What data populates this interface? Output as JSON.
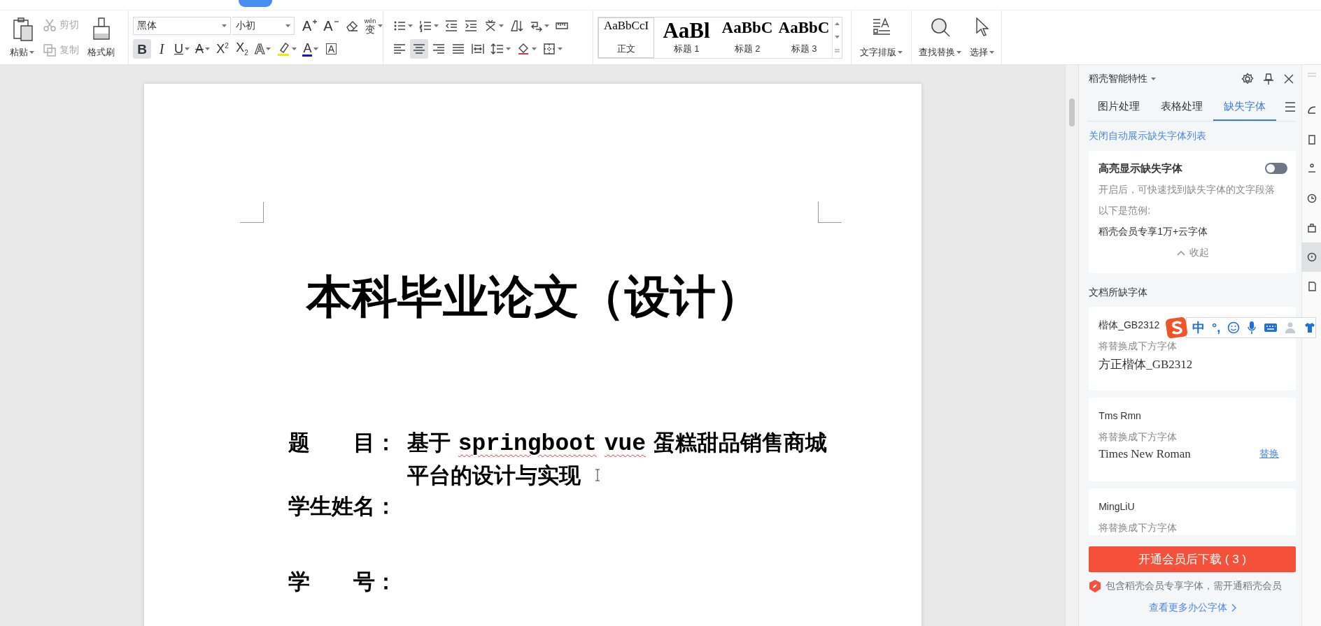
{
  "toolbar": {
    "paste": {
      "label": "粘贴"
    },
    "cut": {
      "label": "剪切",
      "disabled": true
    },
    "copy": {
      "label": "复制",
      "disabled": true
    },
    "format_painter": {
      "label": "格式刷"
    },
    "font_name": "黑体",
    "font_size": "小初",
    "size_buttons": [
      {
        "kind": "grow",
        "glyph": "A"
      },
      {
        "kind": "shrink",
        "glyph": "A"
      }
    ],
    "phonetic_guide": {
      "ruby": "wén",
      "glyph": "变"
    },
    "format_buttons": [
      {
        "kind": "bold",
        "glyph": "B",
        "selected": true
      },
      {
        "kind": "italic",
        "glyph": "I",
        "selected": false
      },
      {
        "kind": "underline",
        "glyph": "U",
        "selected": false
      },
      {
        "kind": "strike",
        "glyph": "A",
        "selected": false
      },
      {
        "kind": "superscript",
        "glyph": "X$^{2}$",
        "selected": false
      },
      {
        "kind": "subscript",
        "glyph": "X$_{2}$",
        "selected": false
      },
      {
        "kind": "effect",
        "glyph": "A",
        "selected": false
      },
      {
        "kind": "highlight",
        "selected": false,
        "color": "#f2ea00"
      },
      {
        "kind": "fontcolor",
        "glyph": "A",
        "selected": false,
        "color": "#1616c8"
      },
      {
        "kind": "border",
        "glyph": "A",
        "selected": false
      }
    ],
    "alignment": [
      {
        "kind": "left",
        "selected": false
      },
      {
        "kind": "center",
        "selected": true
      },
      {
        "kind": "right",
        "selected": false
      },
      {
        "kind": "justify",
        "selected": false
      },
      {
        "kind": "distributed",
        "selected": false
      }
    ],
    "styles": [
      {
        "kind": "normal",
        "preview": "AaBbCcI",
        "label": "正文",
        "selected": true
      },
      {
        "kind": "heading1",
        "preview": "AaBl",
        "label": "标题 1",
        "selected": false
      },
      {
        "kind": "heading2",
        "preview": "AaBbC",
        "label": "标题 2",
        "selected": false
      },
      {
        "kind": "heading3",
        "preview": "AaBbC",
        "label": "标题 3",
        "selected": false
      }
    ],
    "text_layout": "文字排版",
    "find_replace": "查找替换",
    "select": "选择"
  },
  "document": {
    "title": "本科毕业论文（设计）",
    "fields": [
      {
        "label": "题　　目：",
        "lines": [
          [
            {
              "text": "基于 "
            },
            {
              "text": "springboot",
              "misspelled": true
            },
            {
              "text": " vue",
              "misspelled": true
            },
            {
              "text": " 蛋糕甜品销售商城"
            }
          ],
          [
            {
              "text": "平台的设计与实现"
            }
          ]
        ]
      },
      {
        "label": "学生姓名："
      },
      {
        "label": "学　　号："
      }
    ]
  },
  "panel": {
    "title": "稻壳智能特性",
    "tabs": [
      {
        "label": "图片处理",
        "selected": false
      },
      {
        "label": "表格处理",
        "selected": false
      },
      {
        "label": "缺失字体",
        "selected": true
      }
    ],
    "auto_link": "关闭自动展示缺失字体列表",
    "highlight": {
      "title": "高亮显示缺失字体",
      "on": false,
      "description": "开启后，可快速找到缺失字体的文字段落",
      "example_label": "以下是范例:",
      "example": "稻壳会员专享1万+云字体",
      "collapse": "收起"
    },
    "section_title": "文档所缺字体",
    "missing_fonts": [
      {
        "name": "楷体_GB2312",
        "hint": "将替换成下方字体",
        "replacement": "方正楷体_GB2312"
      },
      {
        "name": "Tms Rmn",
        "hint": "将替换成下方字体",
        "replacement": "Times New Roman",
        "action": "替换"
      },
      {
        "name": "MingLiU",
        "hint": "将替换成下方字体"
      }
    ],
    "download_button": "开通会员后下载 ( 3 )",
    "notice": "包含稻壳会员专享字体，需开通稻壳会员",
    "more_link": "查看更多办公字体"
  },
  "ime": {
    "mode": "中",
    "punctuation": "°,"
  },
  "side_tools": [
    {
      "kind": "shape",
      "selected": false
    },
    {
      "kind": "frame",
      "selected": false
    },
    {
      "kind": "share",
      "selected": false
    },
    {
      "kind": "clock",
      "selected": false
    },
    {
      "kind": "bag",
      "selected": false
    },
    {
      "kind": "help",
      "selected": true
    },
    {
      "kind": "page",
      "selected": false
    }
  ]
}
